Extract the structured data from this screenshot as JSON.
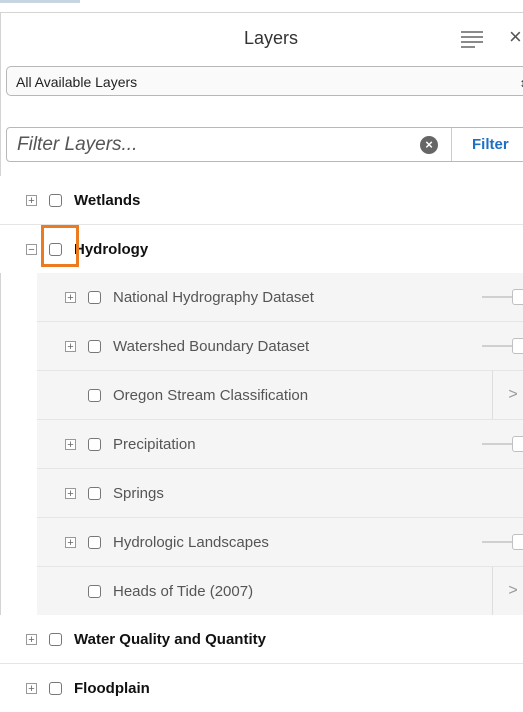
{
  "header": {
    "title": "Layers"
  },
  "layer_select": {
    "value": "All Available Layers"
  },
  "filter": {
    "placeholder": "Filter Layers...",
    "button_label": "Filter"
  },
  "tree": {
    "wetlands": "Wetlands",
    "hydrology": "Hydrology",
    "hydrology_children": [
      {
        "label": "National Hydrography Dataset"
      },
      {
        "label": "Watershed Boundary Dataset"
      },
      {
        "label": "Oregon Stream Classification"
      },
      {
        "label": "Precipitation"
      },
      {
        "label": "Springs"
      },
      {
        "label": "Hydrologic Landscapes"
      },
      {
        "label": "Heads of Tide (2007)"
      }
    ],
    "water_quality": "Water Quality and Quantity",
    "floodplain": "Floodplain"
  },
  "colors": {
    "highlight": "#ec7a21",
    "filter_button": "#1f6fc5"
  }
}
